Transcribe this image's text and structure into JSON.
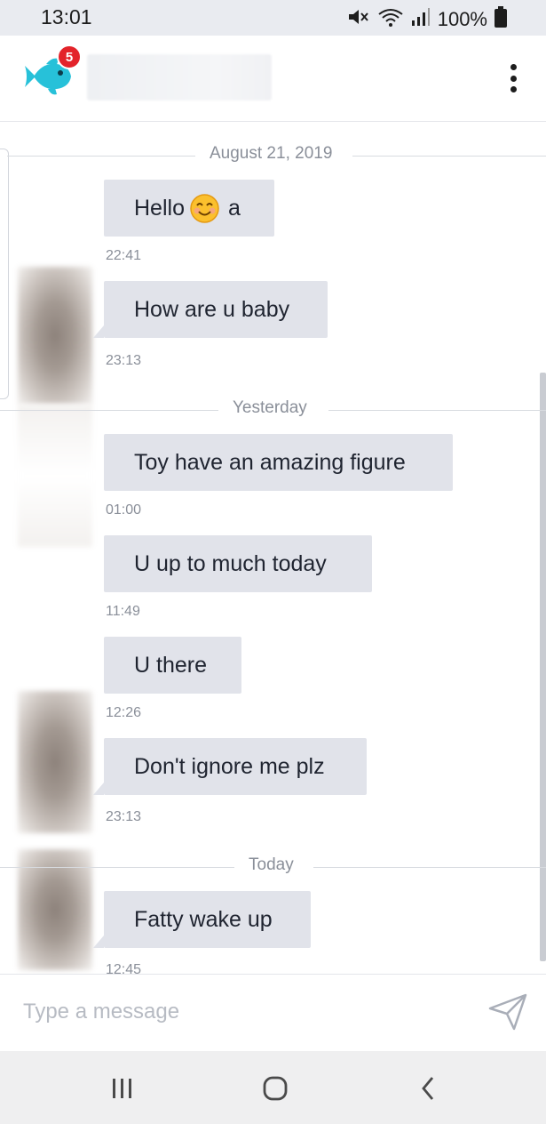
{
  "status_bar": {
    "time": "13:01",
    "battery": "100%",
    "icons": [
      "mute-icon",
      "wifi-icon",
      "signal-icon",
      "battery-icon"
    ]
  },
  "header": {
    "notification_count": "5",
    "logo_icon": "fish-logo-icon",
    "menu_icon": "more-vertical-icon"
  },
  "conversation": {
    "dividers": [
      "August 21, 2019",
      "Yesterday",
      "Today"
    ],
    "messages": [
      {
        "pre": "Hello",
        "emoji": "smiling-face-emoji",
        "post": "a",
        "time": "22:41"
      },
      {
        "text": "How are u baby",
        "time": "23:13"
      },
      {
        "text": "Toy have an amazing figure",
        "time": "01:00"
      },
      {
        "text": "U up to much today",
        "time": "11:49"
      },
      {
        "text": "U there",
        "time": "12:26"
      },
      {
        "text": "Don't ignore me plz",
        "time": "23:13"
      },
      {
        "text": "Fatty wake up",
        "time": "12:45"
      }
    ]
  },
  "composer": {
    "placeholder": "Type a message",
    "value": "",
    "send_icon": "send-icon"
  },
  "nav_bar": {
    "icons": [
      "recent-apps-icon",
      "home-icon",
      "back-icon"
    ]
  },
  "colors": {
    "accent": "#27c1d9",
    "badge": "#e3232a",
    "bubble": "#e1e3ea",
    "timestamp": "#8a8f99"
  }
}
